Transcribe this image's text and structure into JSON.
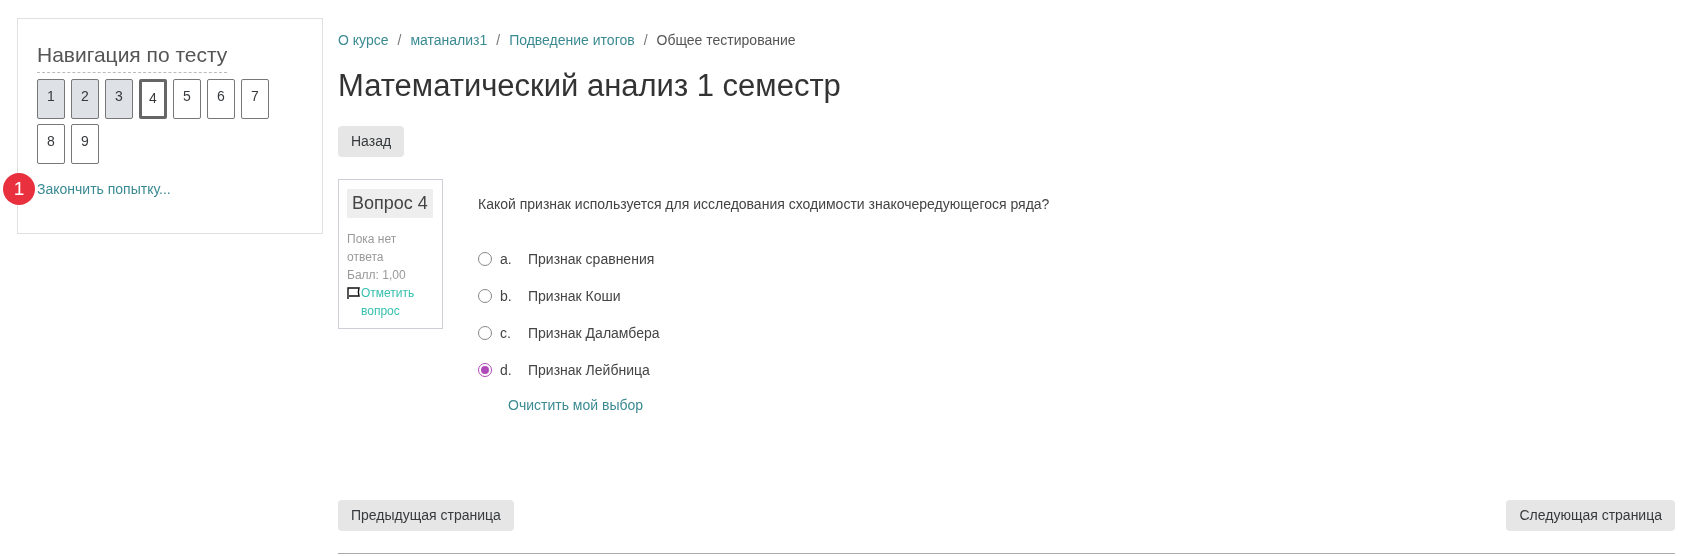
{
  "quiz_navigation": {
    "title": "Навигация по тесту",
    "questions": [
      {
        "label": "1",
        "answered": true,
        "selected": false
      },
      {
        "label": "2",
        "answered": true,
        "selected": false
      },
      {
        "label": "3",
        "answered": true,
        "selected": false
      },
      {
        "label": "4",
        "answered": false,
        "selected": true
      },
      {
        "label": "5",
        "answered": false,
        "selected": false
      },
      {
        "label": "6",
        "answered": false,
        "selected": false
      },
      {
        "label": "7",
        "answered": false,
        "selected": false
      },
      {
        "label": "8",
        "answered": false,
        "selected": false
      },
      {
        "label": "9",
        "answered": false,
        "selected": false
      }
    ],
    "badge": "1",
    "finish_link": "Закончить попытку..."
  },
  "breadcrumbs": [
    {
      "label": "О курсе",
      "link": true
    },
    {
      "label": "матанализ1",
      "link": true
    },
    {
      "label": "Подведение итогов",
      "link": true
    },
    {
      "label": "Общее тестирование",
      "link": false
    }
  ],
  "breadcrumb_separator": "/",
  "title": "Математический анализ 1 семестр",
  "back_button": "Назад",
  "question_info": {
    "heading": "Вопрос 4",
    "status": "Пока нет ответа",
    "grade": "Балл: 1,00",
    "flag_link": "Отметить вопрос"
  },
  "question": {
    "text": "Какой признак используется для исследования сходимости знакочередующегося ряда?",
    "options": [
      {
        "letter": "a.",
        "label": "Признак сравнения",
        "selected": false
      },
      {
        "letter": "b.",
        "label": "Признак Коши",
        "selected": false
      },
      {
        "letter": "c.",
        "label": "Признак Даламбера",
        "selected": false
      },
      {
        "letter": "d.",
        "label": "Признак Лейбница",
        "selected": true
      }
    ],
    "clear_link": "Очистить мой выбор"
  },
  "prev_button": "Предыдущая страница",
  "next_button": "Следующая страница"
}
